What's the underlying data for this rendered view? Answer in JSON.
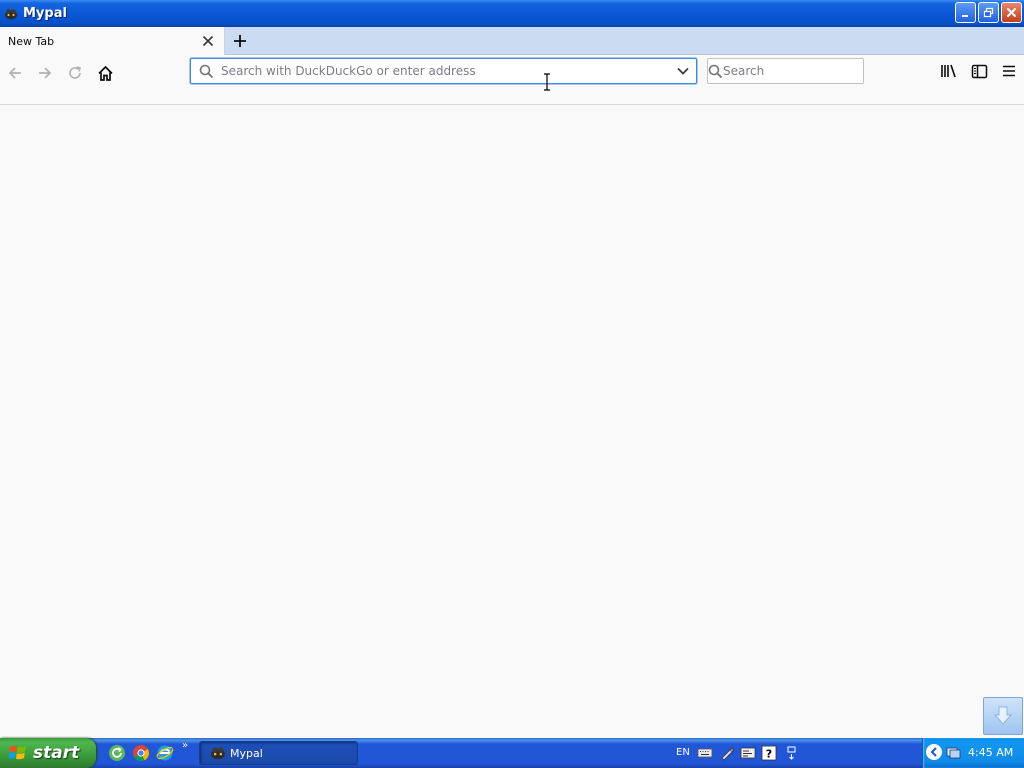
{
  "window": {
    "title": "Mypal"
  },
  "tabs": [
    {
      "label": "New Tab",
      "active": true
    }
  ],
  "toolbar": {
    "urlbar": {
      "value": "",
      "placeholder": "Search with DuckDuckGo or enter address"
    },
    "searchbar": {
      "value": "",
      "placeholder": "Search"
    },
    "icons": {
      "back": "back-arrow-icon",
      "forward": "forward-arrow-icon",
      "reload": "reload-icon",
      "home": "home-icon",
      "library": "library-icon",
      "sidebar": "sidebar-icon",
      "menu": "hamburger-menu-icon"
    }
  },
  "taskbar": {
    "start_label": "start",
    "quicklaunch": [
      "refresh-icon",
      "chrome-icon",
      "internet-explorer-icon"
    ],
    "task_items": [
      {
        "label": "Mypal"
      }
    ],
    "language": "EN",
    "clock": "4:45 AM"
  },
  "colors": {
    "titlebar": "#0a58d8",
    "tabstrip": "#cbdcf2",
    "page_background": "#f9f9fa",
    "taskbar": "#2157d7",
    "start_button": "#3a9a3a",
    "tray": "#0f8be8",
    "urlbar_focus": "#3d8ae0"
  }
}
